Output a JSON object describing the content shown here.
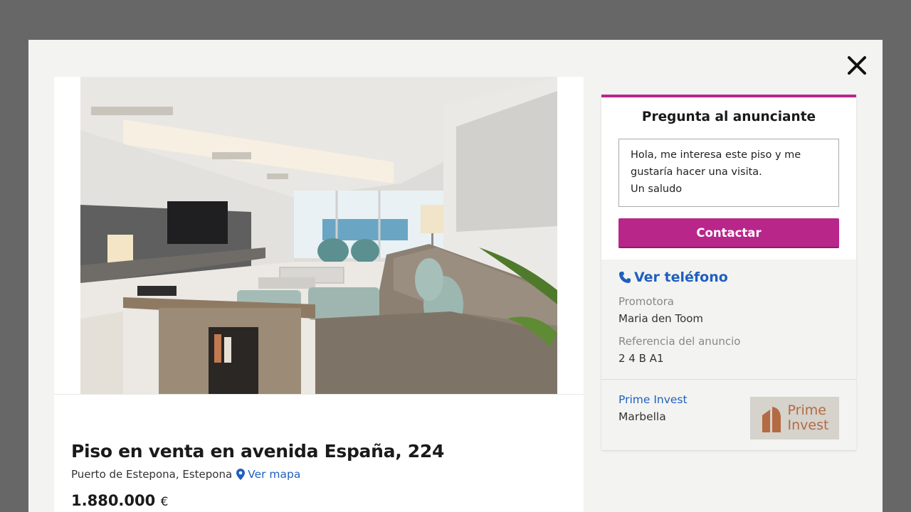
{
  "modal": {
    "close_icon": "close-icon"
  },
  "listing": {
    "title": "Piso en venta en avenida España, 224",
    "location": "Puerto de Estepona, Estepona",
    "map_link": "Ver mapa",
    "price": "1.880.000",
    "currency": "€"
  },
  "contact": {
    "heading": "Pregunta al anunciante",
    "message": "Hola, me interesa este piso y me gustaría hacer una visita.\nUn saludo",
    "button_label": "Contactar",
    "phone_link": "Ver teléfono",
    "promoter_label": "Promotora",
    "promoter_name": "Maria den Toom",
    "reference_label": "Referencia del anuncio",
    "reference_value": "2 4 B A1",
    "agency_name": "Prime Invest",
    "agency_city": "Marbella",
    "logo_line1": "Prime",
    "logo_line2": "Invest"
  },
  "colors": {
    "accent": "#b8268a",
    "link": "#1f5fbf",
    "overlay": "#676767",
    "modal_bg": "#f3f3f1"
  }
}
